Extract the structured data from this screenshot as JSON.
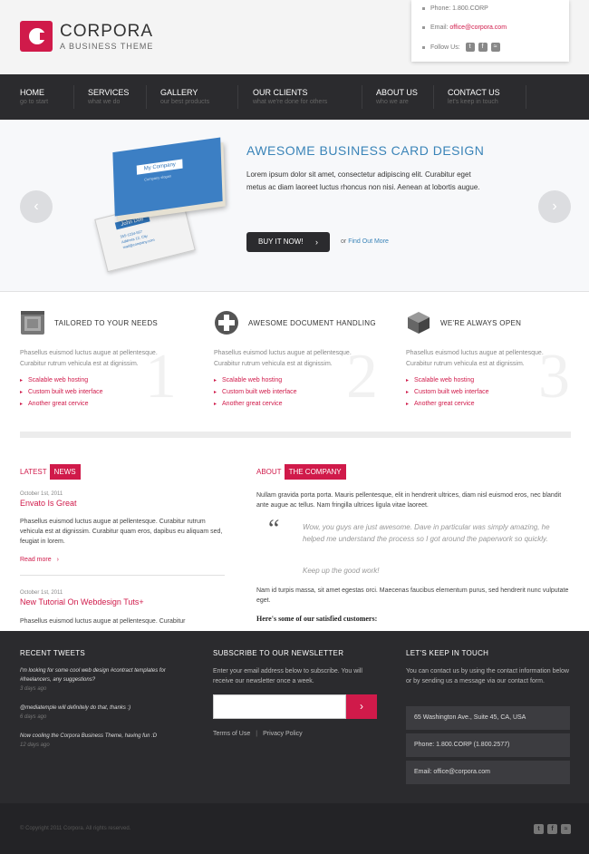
{
  "header": {
    "logo_name": "CORPORA",
    "logo_tagline": "A BUSINESS THEME",
    "phone": "Phone: 1.800.CORP",
    "email_label": "Email: ",
    "email": "office@corpora.com",
    "follow_label": "Follow Us:"
  },
  "nav": [
    {
      "label": "HOME",
      "sub": "go to start"
    },
    {
      "label": "SERVICES",
      "sub": "what we do"
    },
    {
      "label": "GALLERY",
      "sub": "our best products"
    },
    {
      "label": "OUR CLIENTS",
      "sub": "what we're done for others"
    },
    {
      "label": "ABOUT US",
      "sub": "who we are"
    },
    {
      "label": "CONTACT US",
      "sub": "let's keep in touch"
    }
  ],
  "slider": {
    "title": "AWESOME BUSINESS CARD DESIGN",
    "text": "Lorem ipsum dolor sit amet, consectetur adipiscing elit. Curabitur eget metus ac diam laoreet luctus rhoncus non nisi. Aenean at lobortis augue.",
    "button": "BUY IT NOW!",
    "or": "or",
    "link": "Find Out More",
    "card_company": "My Company",
    "card_name": "John Doe"
  },
  "features": [
    {
      "title": "TAILORED TO YOUR NEEDS",
      "text": "Phasellus euismod luctus augue at pellentesque. Curabitur rutrum vehicula est at dignissim.",
      "items": [
        "Scalable web hosting",
        "Custom built web interface",
        "Another great cervice"
      ],
      "icon": "window-icon",
      "num": "1"
    },
    {
      "title": "AWESOME DOCUMENT HANDLING",
      "text": "Phasellus euismod luctus augue at pellentesque. Curabitur rutrum vehicula est at dignissim.",
      "items": [
        "Scalable web hosting",
        "Custom built web interface",
        "Another great cervice"
      ],
      "icon": "plus-icon",
      "num": "2"
    },
    {
      "title": "WE'RE ALWAYS OPEN",
      "text": "Phasellus euismod luctus augue at pellentesque. Curabitur rutrum vehicula est at dignissim.",
      "items": [
        "Scalable web hosting",
        "Custom built web interface",
        "Another great cervice"
      ],
      "icon": "cube-icon",
      "num": "3"
    }
  ],
  "latest": {
    "label": "LATEST",
    "tag": "NEWS",
    "posts": [
      {
        "date": "October 1st, 2011",
        "title": "Envato Is Great",
        "text": "Phasellus euismod luctus augue at pellentesque. Curabitur rutrum vehicula est at dignissim. Curabitur quam eros, dapibus eu aliquam sed, feugiat in lorem.",
        "more": "Read more"
      },
      {
        "date": "October 1st, 2011",
        "title": "New Tutorial On Webdesign Tuts+",
        "text": "Phasellus euismod luctus augue at pellentesque. Curabitur"
      }
    ]
  },
  "about": {
    "label": "ABOUT",
    "tag": "THE COMPANY",
    "para1": "Nullam gravida porta porta. Mauris pellentesque, elit in hendrerit ultrices, diam nisl euismod eros, nec blandit ante augue ac tellus. Nam fringilla ultrices ligula vitae laoreet.",
    "quote": "Wow, you guys are just awesome. Dave in particular was simply amazing, he helped me understand the process so I got around the paperwork so quickly.",
    "quote_end": "Keep up the good work!",
    "para2": "Nam id turpis massa, sit amet egestas orci. Maecenas faucibus elementum purus, sed hendrerit nunc vulputate eget.",
    "customers": "Here's some of our satisfied customers:"
  },
  "footer": {
    "tweets_title": "RECENT TWEETS",
    "tweets": [
      {
        "text": "I'm looking for some cool web design #contract templates for #freelancers, any suggestions?",
        "ago": "3 days ago"
      },
      {
        "text": "@mediatemple will definitely do that, thanks :)",
        "ago": "6 days ago"
      },
      {
        "text": "Now cooling the Corpora Business Theme, having fun :D",
        "ago": "12 days ago"
      }
    ],
    "newsletter_title": "SUBSCRIBE TO OUR NEWSLETTER",
    "newsletter_text": "Enter your email address below to subscribe. You will receive our newsletter once a week.",
    "newsletter_button": "›",
    "terms": "Terms of Use",
    "privacy": "Privacy Policy",
    "touch_title": "LET'S KEEP IN TOUCH",
    "touch_text": "You can contact us by using the contact information below or by sending us a message via our contact form.",
    "address": "65 Washington Ave., Suite 45, CA, USA",
    "phone": "Phone: 1.800.CORP (1.800.2577)",
    "email": "Email: office@corpora.com"
  },
  "copyright": "© Copyright 2011 Corpora. All rights reserved.",
  "colors": {
    "accent": "#d01a4a",
    "blue": "#3a84b8",
    "dark": "#2b2b2e"
  }
}
